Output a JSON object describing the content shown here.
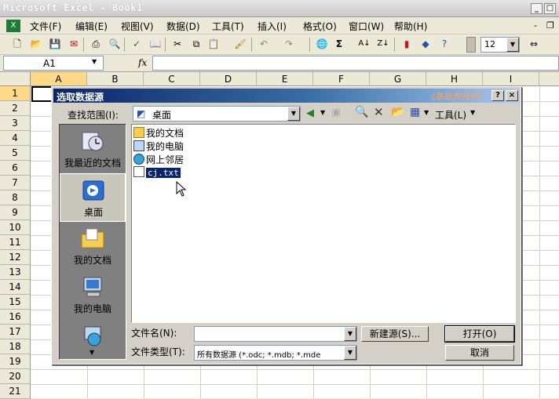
{
  "app": {
    "title": "Microsoft Excel - Book1"
  },
  "menu": [
    "文件(F)",
    "编辑(E)",
    "视图(V)",
    "数据(D)",
    "工具(T)",
    "插入(I)",
    "格式(O)",
    "窗口(W)",
    "帮助(H)"
  ],
  "toolbar": {
    "font_size": "12"
  },
  "formula_bar": {
    "name_box": "A1",
    "fx": "fx",
    "formula": ""
  },
  "grid": {
    "columns": [
      "A",
      "B",
      "C",
      "D",
      "E",
      "F",
      "G",
      "H",
      "I"
    ],
    "rows": [
      "1",
      "2",
      "3",
      "4",
      "5",
      "6",
      "7",
      "8",
      "9",
      "10",
      "11",
      "12",
      "13",
      "14",
      "15",
      "16",
      "17",
      "18",
      "19",
      "20",
      "21"
    ]
  },
  "dialog": {
    "title": "选取数据源",
    "watermark": "《基础教程网》",
    "help_btn": "?",
    "close_btn": "×",
    "lookin_label": "查找范围(I):",
    "lookin_value": "桌面",
    "tools_label": "工具(L)",
    "places": [
      "我最近的文档",
      "桌面",
      "我的文档",
      "我的电脑",
      ""
    ],
    "files": [
      "我的文档",
      "我的电脑",
      "网上邻居",
      "cj.txt"
    ],
    "filename_label": "文件名(N):",
    "filename_value": "",
    "filetype_label": "文件类型(T):",
    "filetype_value": "所有数据源 (*.odc; *.mdb; *.mde",
    "new_source_btn": "新建源(S)...",
    "open_btn": "打开(O)",
    "cancel_btn": "取消"
  },
  "colors": {
    "title_gradient_start": "#0a246a",
    "selection": "#0a246a",
    "watermark": "#f3a36a"
  }
}
